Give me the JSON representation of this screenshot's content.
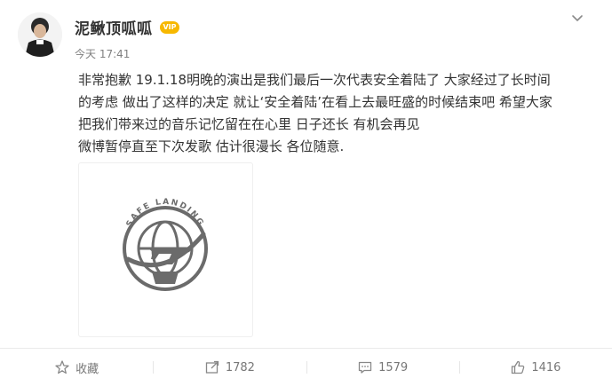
{
  "post": {
    "username": "泥鳅顶呱呱",
    "vip_badge": "VIP",
    "timestamp": "今天 17:41",
    "content_lines": [
      "非常抱歉 19.1.18明晚的演出是我们最后一次代表安全着陆了 大家经过了长时间",
      "的考虑 做出了这样的决定 就让‘安全着陆’在看上去最旺盛的时候结束吧 希望大家",
      "把我们带来过的音乐记忆留在在心里 日子还长 有机会再见",
      "微博暂停直至下次发歌 估计很漫长 各位随意."
    ],
    "image_text": "SAFE LANDING"
  },
  "actions": {
    "favorite_label": "收藏",
    "repost_count": "1782",
    "comment_count": "1579",
    "like_count": "1416"
  },
  "icons": {
    "more": "chevron-down-icon",
    "favorite": "star-icon",
    "repost": "repost-icon",
    "comment": "comment-icon",
    "like": "thumbs-up-icon"
  },
  "colors": {
    "text": "#333333",
    "muted": "#808080",
    "vip_badge": "#f7b800",
    "logo_gray": "#6b6b6b"
  }
}
